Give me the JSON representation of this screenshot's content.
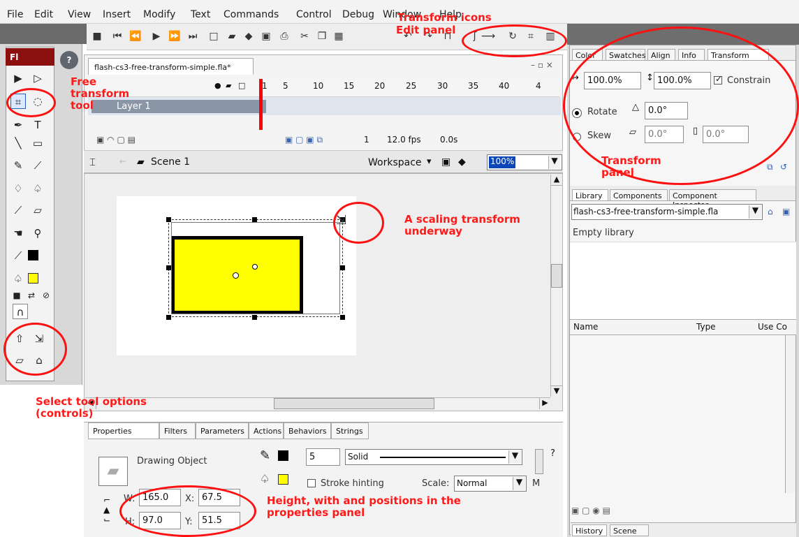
{
  "menu": [
    "File",
    "Edit",
    "View",
    "Insert",
    "Modify",
    "Text",
    "Commands",
    "Control",
    "Debug",
    "Window",
    "Help"
  ],
  "document": {
    "tab": "flash-cs3-free-transform-simple.fla*",
    "timeline": {
      "layer_name": "Layer 1",
      "frames": [
        "1",
        "5",
        "10",
        "15",
        "20",
        "25",
        "30",
        "35",
        "40",
        "4"
      ],
      "fps": "12.0 fps",
      "time": "0.0s",
      "frame": "1"
    },
    "scene": "Scene 1",
    "workspace": "Workspace",
    "zoom": "100%"
  },
  "toolbox": {
    "brand": "Fl"
  },
  "properties": {
    "tabs": [
      "Properties",
      "Filters",
      "Parameters",
      "Actions",
      "Behaviors",
      "Strings"
    ],
    "object_type": "Drawing Object",
    "stroke_size": "5",
    "stroke_style": "Solid",
    "stroke_hinting": "Stroke hinting",
    "scale_label": "Scale:",
    "scale_value": "Normal",
    "m_label": "M",
    "w_label": "W:",
    "h_label": "H:",
    "x_label": "X:",
    "y_label": "Y:",
    "width": "165.0",
    "height": "97.0",
    "x": "67.5",
    "y": "51.5"
  },
  "transform_panel": {
    "tabs": [
      "Color",
      "Swatches",
      "Align",
      "Info",
      "Transform"
    ],
    "scale_w": "100.0%",
    "scale_h": "100.0%",
    "constrain": "Constrain",
    "rotate": "Rotate",
    "rotate_value": "0.0°",
    "skew": "Skew",
    "skew_h": "0.0°",
    "skew_v": "0.0°"
  },
  "library_panel": {
    "tabs": [
      "Library",
      "Components",
      "Component Inspector"
    ],
    "file": "flash-cs3-free-transform-simple.fla",
    "empty": "Empty library",
    "columns": [
      "Name",
      "Type",
      "Use Co"
    ]
  },
  "bottom_panel": {
    "tabs": [
      "History",
      "Scene"
    ]
  },
  "annotations": {
    "free_transform": "Free transform tool",
    "transform_icons": "Transform icons",
    "edit_panel": "Edit panel",
    "transform_panel": "Transform panel",
    "scaling": "A scaling transform underway",
    "select_options": "Select tool options (controls)",
    "props_note": "Height, with and positions in the properties panel"
  }
}
